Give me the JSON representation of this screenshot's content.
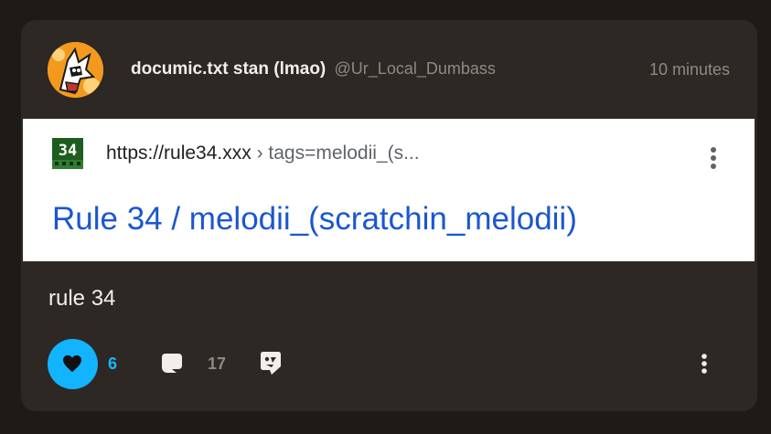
{
  "post": {
    "author": {
      "display_name": "documic.txt stan (lmao)",
      "handle": "@Ur_Local_Dumbass",
      "avatar_icon": "hedgehog-avatar-icon"
    },
    "timestamp": "10 minutes",
    "embed": {
      "favicon_text": "34",
      "url_host": "https://rule34.xxx",
      "url_path": " › tags=melodii_(s...",
      "title": "Rule 34 / melodii_(scratchin_melodii)",
      "menu_icon": "more-vertical-icon"
    },
    "text": "rule 34",
    "actions": {
      "like_count": "6",
      "comment_count": "17",
      "like_icon": "heart-icon",
      "comment_icon": "comment-bubble-icon",
      "share_icon": "share-icon",
      "more_icon": "more-vertical-icon"
    }
  },
  "colors": {
    "background": "#1e1a17",
    "card": "#2d2823",
    "accent": "#12b4ff",
    "link": "#1a57d0",
    "muted": "#8f8983"
  }
}
